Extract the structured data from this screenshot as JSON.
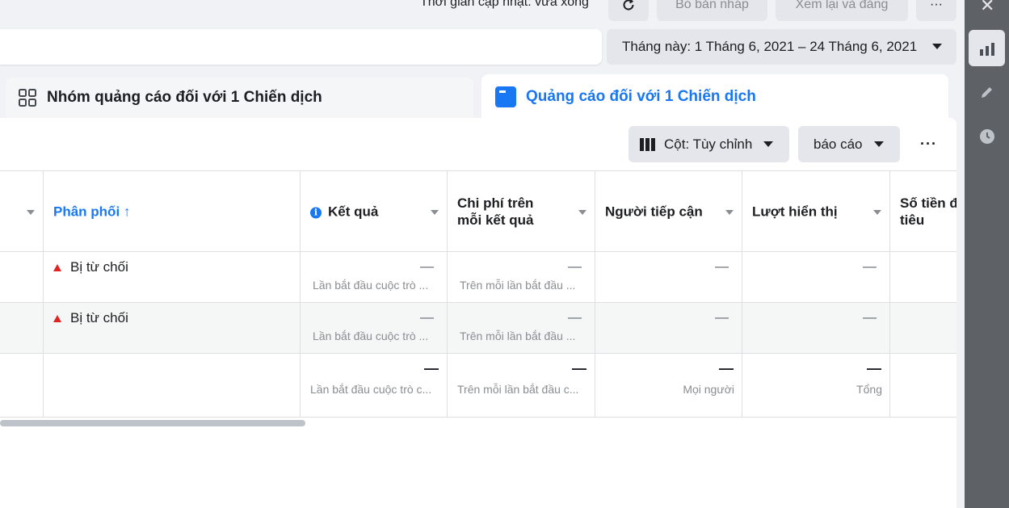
{
  "topbar": {
    "update_text": "Thời gian cập nhật: vừa xong",
    "discard_label": "Bỏ bản nháp",
    "review_label": "Xem lại và đăng",
    "more_label": "···"
  },
  "date_range": {
    "label": "Tháng này: 1 Tháng 6, 2021 – 24 Tháng 6, 2021"
  },
  "tabs": {
    "adsets": "Nhóm quảng cáo đối với 1 Chiến dịch",
    "ads": "Quảng cáo đối với 1 Chiến dịch"
  },
  "toolbar": {
    "columns_label": "Cột: Tùy chỉnh",
    "report_label": "báo cáo",
    "more_label": "···"
  },
  "table": {
    "headers": {
      "delivery": "Phân phối",
      "delivery_sort": "↑",
      "results": "Kết quả",
      "cost_per_result_line1": "Chi phí trên",
      "cost_per_result_line2": "mỗi kết quả",
      "reach": "Người tiếp cận",
      "impressions": "Lượt hiển thị",
      "amount_spent_line1": "Số tiền đ",
      "amount_spent_line2": "tiêu"
    },
    "rows": [
      {
        "status": "Bị từ chối",
        "results": "—",
        "results_sub": "Lần bắt đầu cuộc trò ...",
        "cost": "—",
        "cost_sub": "Trên mỗi lần bắt đầu ...",
        "reach": "—",
        "impressions": "—"
      },
      {
        "status": "Bị từ chối",
        "results": "—",
        "results_sub": "Lần bắt đầu cuộc trò ...",
        "cost": "—",
        "cost_sub": "Trên mỗi lần bắt đầu ...",
        "reach": "—",
        "impressions": "—"
      }
    ],
    "totals": {
      "results": "—",
      "results_sub": "Lần bắt đầu cuộc trò c...",
      "cost": "—",
      "cost_sub": "Trên mỗi lần bắt đầu c...",
      "reach": "—",
      "reach_sub": "Mọi người",
      "impressions": "—",
      "impressions_sub": "Tổng"
    }
  },
  "icons": {
    "sidebar": [
      "close-icon",
      "chart-icon",
      "pencil-icon",
      "clock-icon"
    ]
  },
  "colors": {
    "accent": "#1877f2",
    "warning": "#e02424",
    "sidebar": "#5e6166"
  }
}
